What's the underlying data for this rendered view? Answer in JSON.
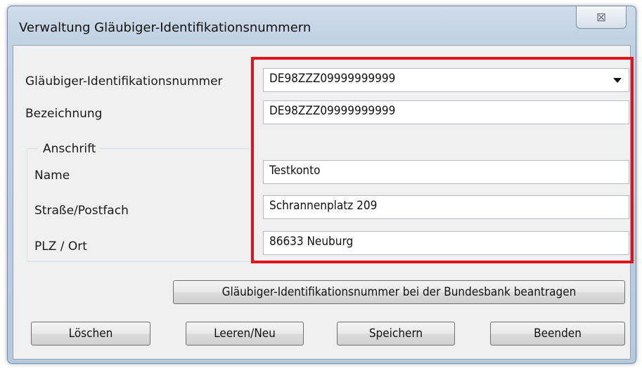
{
  "window": {
    "title": "Verwaltung Gläubiger-Identifikationsnummern",
    "close_glyph": "⊠"
  },
  "form": {
    "glaeubiger_id": {
      "label": "Gläubiger-Identifikationsnummer",
      "value": "DE98ZZZ09999999999"
    },
    "bezeichnung": {
      "label": "Bezeichnung",
      "value": "DE98ZZZ09999999999"
    },
    "anschrift": {
      "legend": "Anschrift",
      "name": {
        "label": "Name",
        "value": "Testkonto"
      },
      "strasse": {
        "label": "Straße/Postfach",
        "value": "Schrannenplatz 209"
      },
      "plz_ort": {
        "label": "PLZ / Ort",
        "value": "86633 Neuburg"
      }
    }
  },
  "buttons": {
    "beantragen": "Gläubiger-Identifikationsnummer bei der Bundesbank beantragen",
    "loeschen": "Löschen",
    "leeren_neu": "Leeren/Neu",
    "speichern": "Speichern",
    "beenden": "Beenden"
  },
  "colors": {
    "highlight": "#e0141c",
    "dialog_background": "#f0f0f0",
    "frame": "#bfd0e2"
  }
}
